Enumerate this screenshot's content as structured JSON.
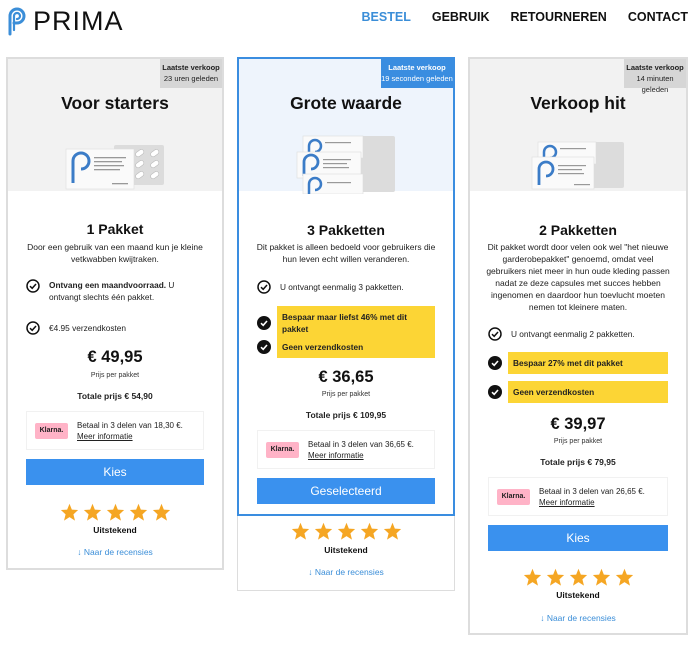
{
  "header": {
    "logo_text": "PRIMA",
    "nav": [
      {
        "label": "BESTEL",
        "active": true
      },
      {
        "label": "GEBRUIK",
        "active": false
      },
      {
        "label": "RETOURNEREN",
        "active": false
      },
      {
        "label": "CONTACT",
        "active": false
      }
    ]
  },
  "colors": {
    "accent_blue": "#3a8de0",
    "button_blue": "#3a91ee",
    "highlight_yellow": "#fcd535",
    "star_orange": "#f5a623",
    "klarna_pink": "#ffb3c7"
  },
  "cards": [
    {
      "badge_title": "Laatste verkoop",
      "badge_time": "23 uren geleden",
      "title": "Voor starters",
      "pkg_title": "1 Pakket",
      "description": "Door een gebruik van een maand kun je kleine vetkwabben kwijtraken.",
      "features": [
        {
          "bold": "Ontvang een maandvoorraad.",
          "text": " U ontvangt slechts één pakket.",
          "highlight": false
        },
        {
          "bold": "",
          "text": "€4.95 verzendkosten",
          "highlight": false
        }
      ],
      "price": "€ 49,95",
      "price_sub": "Prijs per pakket",
      "total": "Totale prijs € 54,90",
      "klarna_logo": "Klarna.",
      "klarna_text": "Betaal in 3 delen van 18,30 €.",
      "klarna_link": "Meer informatie",
      "button": "Kies",
      "rating_stars": 5,
      "rating_label": "Uitstekend",
      "review_link": "Naar de recensies",
      "selected": false
    },
    {
      "badge_title": "Laatste verkoop",
      "badge_time": "19 seconden geleden",
      "title": "Grote waarde",
      "pkg_title": "3 Pakketten",
      "description": "Dit pakket is alleen bedoeld voor gebruikers die hun leven echt willen veranderen.",
      "features": [
        {
          "bold": "",
          "text": "U ontvangt eenmalig 3 pakketten.",
          "highlight": false
        },
        {
          "bold": "",
          "text": "Bespaar maar liefst 46% met dit pakket",
          "highlight": true
        },
        {
          "bold": "",
          "text": "Geen verzendkosten",
          "highlight": true
        }
      ],
      "price": "€ 36,65",
      "price_sub": "Prijs per pakket",
      "total": "Totale prijs € 109,95",
      "klarna_logo": "Klarna.",
      "klarna_text": "Betaal in 3 delen van 36,65 €.",
      "klarna_link": "Meer informatie",
      "button": "Geselecteerd",
      "rating_stars": 5,
      "rating_label": "Uitstekend",
      "review_link": "Naar de recensies",
      "selected": true
    },
    {
      "badge_title": "Laatste verkoop",
      "badge_time": "14 minuten geleden",
      "title": "Verkoop hit",
      "pkg_title": "2 Pakketten",
      "description": "Dit pakket wordt door velen ook wel \"het nieuwe garderobepakket\" genoemd, omdat veel gebruikers niet meer in hun oude kleding passen nadat ze deze capsules met succes hebben ingenomen en daardoor hun toevlucht moeten nemen tot kleinere maten.",
      "features": [
        {
          "bold": "",
          "text": "U ontvangt eenmalig 2 pakketten.",
          "highlight": false
        },
        {
          "bold": "",
          "text": "Bespaar 27% met dit pakket",
          "highlight": true
        },
        {
          "bold": "",
          "text": "Geen verzendkosten",
          "highlight": true
        }
      ],
      "price": "€ 39,97",
      "price_sub": "Prijs per pakket",
      "total": "Totale prijs € 79,95",
      "klarna_logo": "Klarna.",
      "klarna_text": "Betaal in 3 delen van 26,65 €.",
      "klarna_link": "Meer informatie",
      "button": "Kies",
      "rating_stars": 5,
      "rating_label": "Uitstekend",
      "review_link": "Naar de recensies",
      "selected": false
    }
  ]
}
